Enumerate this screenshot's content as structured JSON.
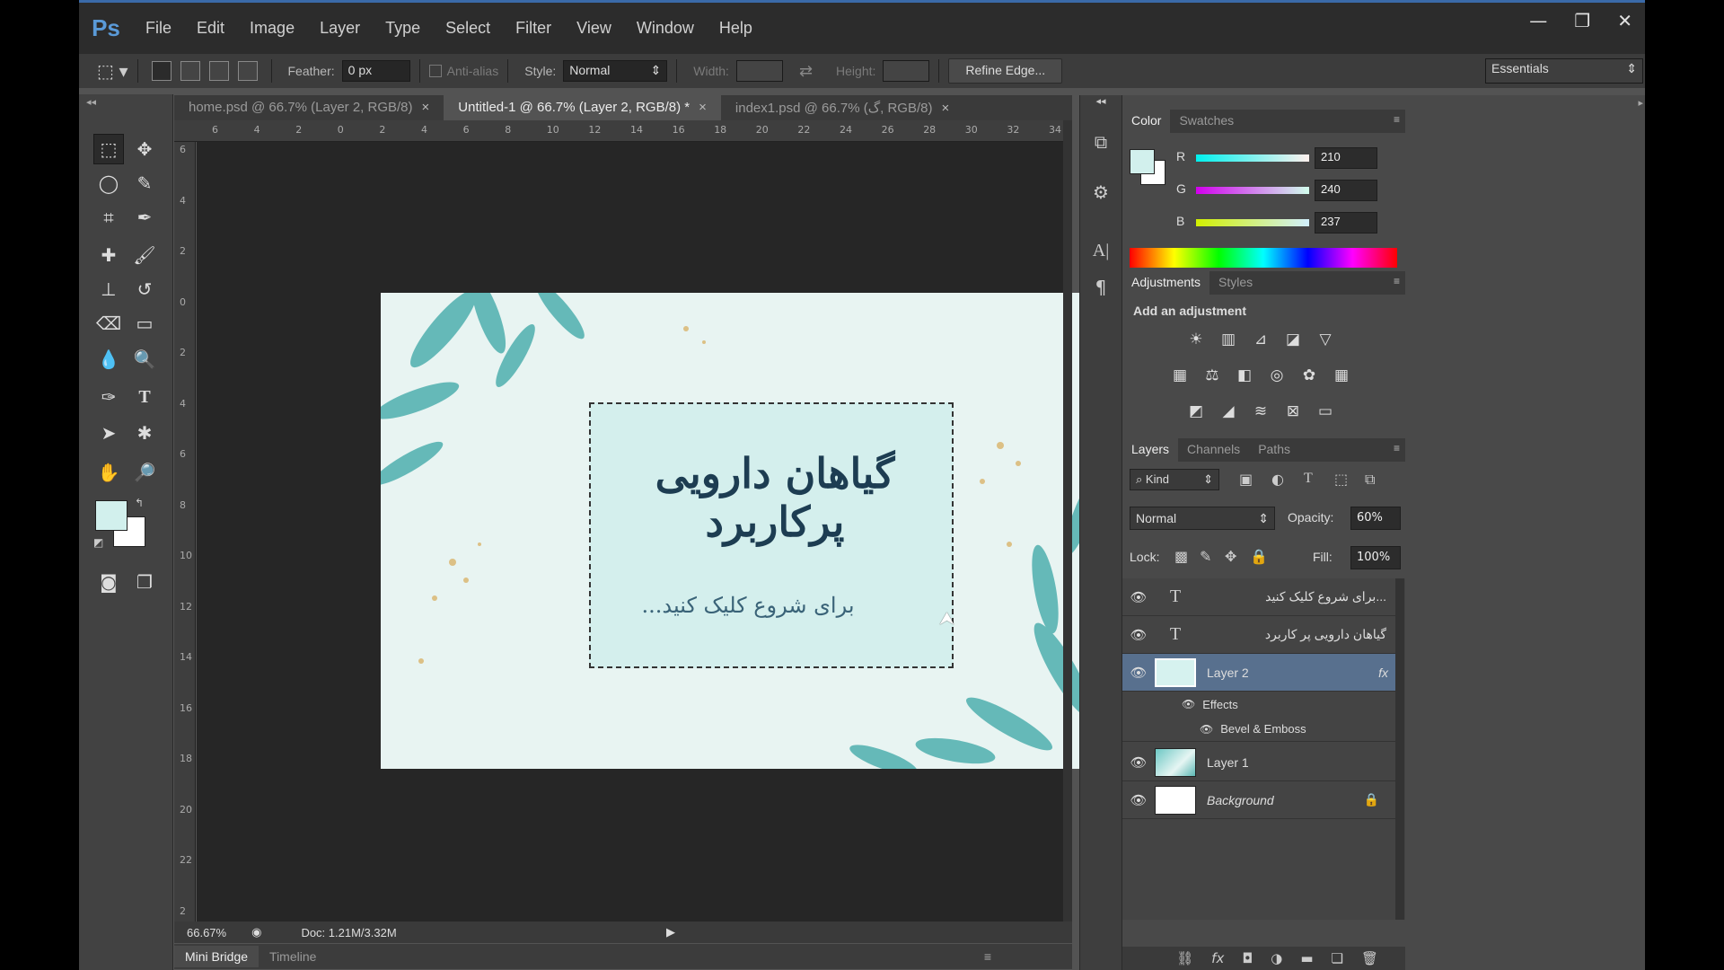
{
  "app": {
    "logo": "Ps",
    "menu": [
      "File",
      "Edit",
      "Image",
      "Layer",
      "Type",
      "Select",
      "Filter",
      "View",
      "Window",
      "Help"
    ],
    "window_controls": {
      "minimize": "—",
      "maximize": "❐",
      "close": "✕"
    }
  },
  "options": {
    "feather_label": "Feather:",
    "feather_value": "0 px",
    "antialias_label": "Anti-alias",
    "style_label": "Style:",
    "style_value": "Normal",
    "width_label": "Width:",
    "height_label": "Height:",
    "refine_edge": "Refine Edge...",
    "workspace": "Essentials"
  },
  "tabs": [
    {
      "label": "home.psd @ 66.7% (Layer 2, RGB/8)",
      "close": "×"
    },
    {
      "label": "Untitled-1 @ 66.7% (Layer 2, RGB/8) *",
      "close": "×"
    },
    {
      "label": "index1.psd @ 66.7% (گ, RGB/8)",
      "close": "×"
    }
  ],
  "ruler": {
    "h": [
      "6",
      "4",
      "2",
      "0",
      "2",
      "4",
      "6",
      "8",
      "10",
      "12",
      "14",
      "16",
      "18",
      "20",
      "22",
      "24",
      "26",
      "28",
      "30",
      "32",
      "34"
    ],
    "v": [
      "6",
      "4",
      "2",
      "0",
      "2",
      "4",
      "6",
      "8",
      "10",
      "12",
      "14",
      "16",
      "18",
      "20",
      "22",
      "2"
    ]
  },
  "document": {
    "title": "گیاهان دارویی پرکاربرد",
    "subtitle": "برای شروع کلیک کنید..."
  },
  "status": {
    "zoom": "66.67%",
    "doc": "Doc: 1.21M/3.32M"
  },
  "bottom_tabs": [
    "Mini Bridge",
    "Timeline"
  ],
  "color_panel": {
    "tabs": [
      "Color",
      "Swatches"
    ],
    "r_label": "R",
    "r": "210",
    "g_label": "G",
    "g": "240",
    "b_label": "B",
    "b": "237",
    "foreground": "#d2f0ed"
  },
  "adjustments": {
    "tabs": [
      "Adjustments",
      "Styles"
    ],
    "heading": "Add an adjustment"
  },
  "layers_panel": {
    "tabs": [
      "Layers",
      "Channels",
      "Paths"
    ],
    "kind": "Kind",
    "blend_mode": "Normal",
    "opacity_label": "Opacity:",
    "opacity": "60%",
    "lock_label": "Lock:",
    "fill_label": "Fill:",
    "fill": "100%",
    "layers": [
      {
        "name": "...برای شروع کلیک کنید",
        "type": "T"
      },
      {
        "name": "گیاهان دارویی پر کاربرد",
        "type": "T"
      },
      {
        "name": "Layer 2",
        "fx": "fx"
      },
      {
        "name": "Effects"
      },
      {
        "name": "Bevel & Emboss"
      },
      {
        "name": "Layer 1"
      },
      {
        "name": "Background"
      }
    ]
  }
}
